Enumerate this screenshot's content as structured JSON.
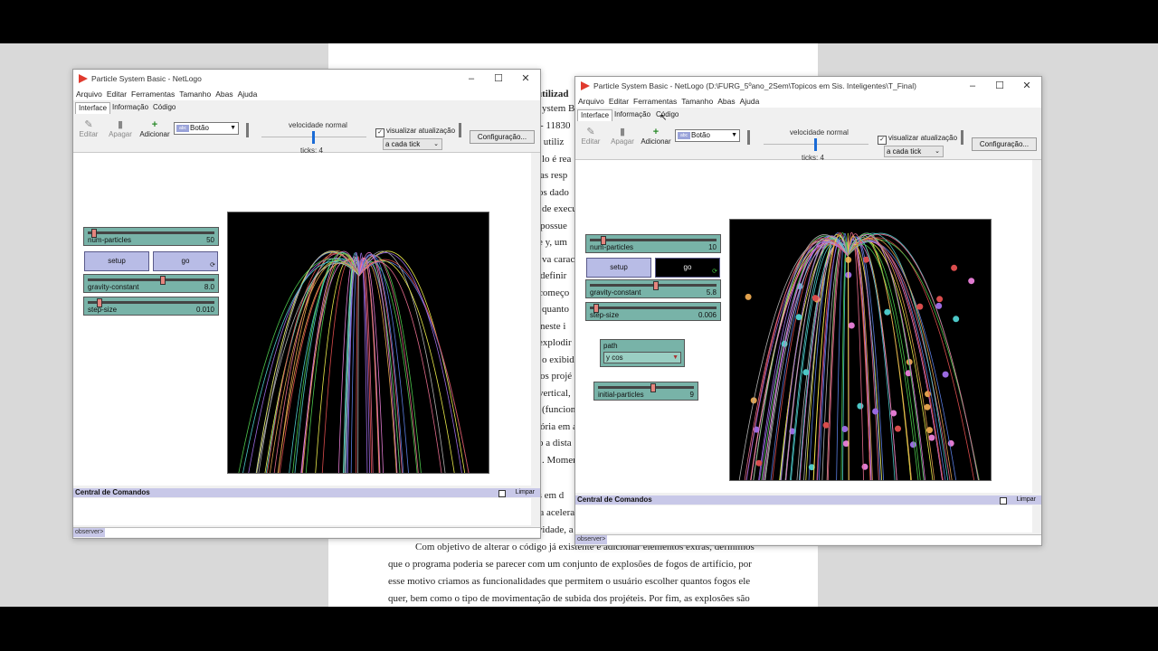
{
  "document": {
    "title_fragment": "utilizad",
    "left_fragments": [
      "ystem B",
      "- 11830",
      "i utiliz",
      "lo é rea",
      "as resp",
      "os dado",
      "de execu",
      "possue",
      "e y, um",
      "va carac",
      "definir",
      "começo",
      "quanto",
      "neste i",
      "explodir",
      "o exibida",
      "os projé",
      "vertical,",
      "(funciona",
      "ória em a",
      "o a dista",
      ". Momer"
    ],
    "lines": [
      "explodem, e n projéteis são disparados em d",
      "caindo no chão em sequência com uma aceleração definida pela gravidade. Sendo a única",
      "força exercida pelo ambiente a da gravidade, a qual também pode ser alterada.",
      "Com objetivo de alterar o código já existente e adicionar elementos extras, definimos",
      "que o programa poderia se parecer com um conjunto de explosões de fogos de artifício, por",
      "esse motivo criamos as funcionalidades que permitem o usuário escolher quantos fogos ele",
      "quer, bem como o tipo de movimentação de subida dos projéteis. Por fim, as explosões são"
    ]
  },
  "common": {
    "menu": [
      "Arquivo",
      "Editar",
      "Ferramentas",
      "Tamanho",
      "Abas",
      "Ajuda"
    ],
    "tabs": [
      "Interface",
      "Informação",
      "Código"
    ],
    "toolbar": {
      "edit": "Editar",
      "delete": "Apagar",
      "add": "Adicionar",
      "widget_type": "Botão",
      "speed": "velocidade normal",
      "view_updates": "visualizar atualização",
      "update_mode": "a cada tick",
      "settings": "Configuração..."
    },
    "command_center": {
      "title": "Central de Comandos",
      "clear": "Limpar",
      "prompt": "observer>"
    },
    "colors": {
      "slider": "#78b3a8",
      "button": "#b8bce6",
      "logo": "#e03a2e"
    }
  },
  "window1": {
    "title": "Particle System Basic - NetLogo",
    "ticks": "ticks: 4",
    "widgets": {
      "num_particles": {
        "name": "num-particles",
        "value": "50",
        "fraction": 0.05
      },
      "setup": "setup",
      "go": "go",
      "gravity": {
        "name": "gravity-constant",
        "value": "8.0",
        "fraction": 0.6
      },
      "step_size": {
        "name": "step-size",
        "value": "0.010",
        "fraction": 0.1
      }
    }
  },
  "window2": {
    "title": "Particle System Basic - NetLogo (D:\\FURG_5ºano_2Sem\\Topicos em Sis. Inteligentes\\T_Final)",
    "ticks": "ticks: 4",
    "widgets": {
      "num_particles": {
        "name": "num-particles",
        "value": "10",
        "fraction": 0.1
      },
      "setup": "setup",
      "go": "go",
      "gravity": {
        "name": "gravity-constant",
        "value": "5.8",
        "fraction": 0.5
      },
      "step_size": {
        "name": "step-size",
        "value": "0.006",
        "fraction": 0.06
      },
      "path": {
        "name": "path",
        "value": "y cos"
      },
      "initial_particles": {
        "name": "initial-particles",
        "value": "9",
        "fraction": 0.6
      }
    }
  }
}
